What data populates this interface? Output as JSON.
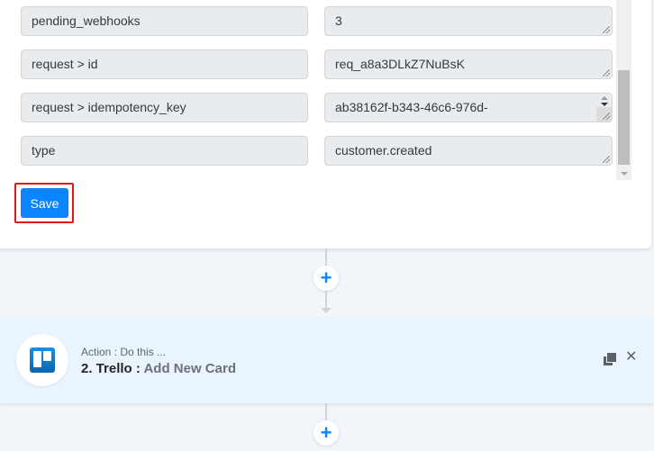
{
  "fields": [
    {
      "key": "pending_webhooks",
      "value": "3",
      "spinner": false
    },
    {
      "key": "request > id",
      "value": "req_a8a3DLkZ7NuBsK",
      "spinner": false
    },
    {
      "key": "request > idempotency_key",
      "value": "ab38162f-b343-46c6-976d-",
      "spinner": true
    },
    {
      "key": "type",
      "value": "customer.created",
      "spinner": false
    }
  ],
  "save_label": "Save",
  "add_step_symbol": "+",
  "action": {
    "subtitle": "Action : Do this ...",
    "step_label": "2. Trello : ",
    "event": "Add New Card",
    "app_icon": "trello-icon",
    "close_symbol": "✕"
  },
  "colors": {
    "accent": "#0a84ff",
    "highlight": "#e0141e",
    "action_bg": "#eaf4fd"
  }
}
